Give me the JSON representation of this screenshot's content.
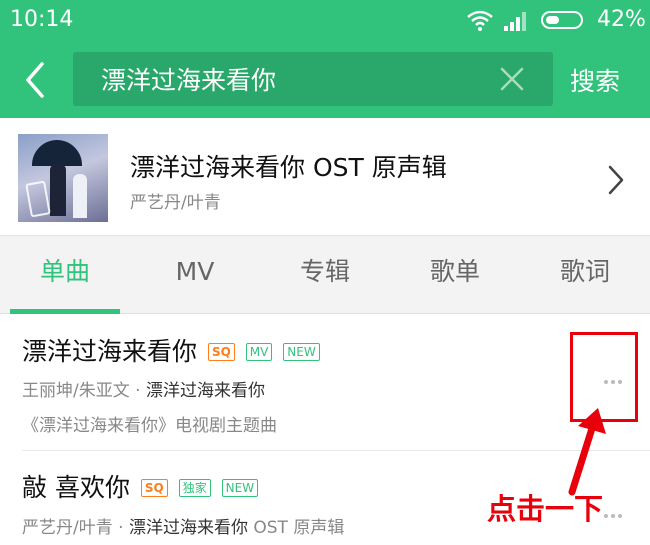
{
  "status_bar": {
    "time": "10:14",
    "battery_percent": "42%",
    "battery_level": 0.42
  },
  "header": {
    "search_value": "漂洋过海来看你",
    "search_button": "搜索",
    "back_icon": "chevron-left-icon",
    "clear_icon": "close-icon"
  },
  "album": {
    "title": "漂洋过海来看你 OST 原声辑",
    "artist": "严艺丹/叶青",
    "chevron_icon": "chevron-right-icon"
  },
  "tabs": [
    {
      "label": "单曲",
      "active": true
    },
    {
      "label": "MV",
      "active": false
    },
    {
      "label": "专辑",
      "active": false
    },
    {
      "label": "歌单",
      "active": false
    },
    {
      "label": "歌词",
      "active": false
    }
  ],
  "songs": [
    {
      "title": "漂洋过海来看你",
      "badges": [
        "SQ",
        "MV",
        "NEW"
      ],
      "artist": "王丽坤/朱亚文",
      "separator": " · ",
      "album": "漂洋过海来看你",
      "description": "《漂洋过海来看你》电视剧主题曲"
    },
    {
      "title": "敲 喜欢你",
      "badges": [
        "SQ",
        "独家",
        "NEW"
      ],
      "artist": "严艺丹/叶青",
      "separator": " · ",
      "album": "漂洋过海来看你",
      "album_suffix": " OST 原声辑"
    }
  ],
  "annotation": {
    "label": "点击一下",
    "color": "#e8000b"
  },
  "colors": {
    "brand": "#31c27c",
    "sq_badge": "#ff7d1a",
    "annotation": "#e8000b"
  }
}
